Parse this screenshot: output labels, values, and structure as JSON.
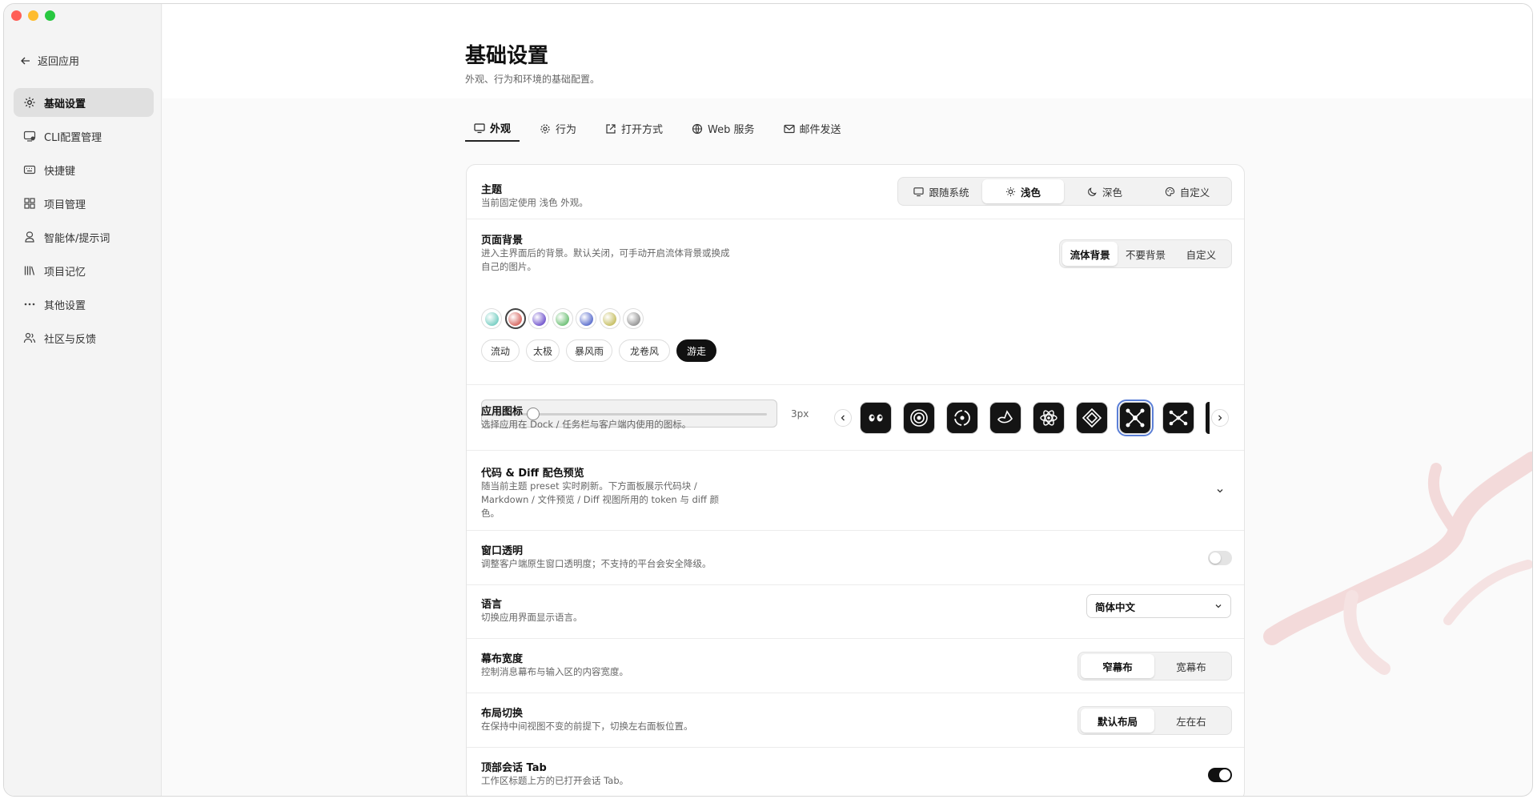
{
  "window": {
    "colors": {
      "close": "#ff5f57",
      "minimize": "#febc2e",
      "zoom": "#28c840"
    }
  },
  "sidebar": {
    "back_label": "返回应用",
    "items": [
      {
        "label": "基础设置",
        "icon": "gear-icon",
        "active": true
      },
      {
        "label": "CLI配置管理",
        "icon": "monitor-icon"
      },
      {
        "label": "快捷键",
        "icon": "keyboard-icon"
      },
      {
        "label": "项目管理",
        "icon": "grid-icon"
      },
      {
        "label": "智能体/提示词",
        "icon": "agent-icon"
      },
      {
        "label": "项目记忆",
        "icon": "library-icon"
      },
      {
        "label": "其他设置",
        "icon": "more-icon"
      },
      {
        "label": "社区与反馈",
        "icon": "users-icon"
      }
    ]
  },
  "page": {
    "title": "基础设置",
    "subtitle": "外观、行为和环境的基础配置。"
  },
  "tabs": [
    {
      "label": "外观",
      "icon": "monitor-icon",
      "active": true
    },
    {
      "label": "行为",
      "icon": "gear-icon"
    },
    {
      "label": "打开方式",
      "icon": "external-link-icon"
    },
    {
      "label": "Web 服务",
      "icon": "globe-icon"
    },
    {
      "label": "邮件发送",
      "icon": "mail-icon"
    }
  ],
  "theme": {
    "title": "主题",
    "desc": "当前固定使用 浅色 外观。",
    "options": [
      "跟随系统",
      "浅色",
      "深色",
      "自定义"
    ],
    "selected": "浅色"
  },
  "background": {
    "title": "页面背景",
    "desc": "进入主界面后的背景。默认关闭，可手动开启流体背景或换成自己的图片。",
    "modes": [
      "流体背景",
      "不要背景",
      "自定义"
    ],
    "selected_mode": "流体背景",
    "swatches": [
      "#7fd1c6",
      "#d9706a",
      "#7a5fd0",
      "#76c47e",
      "#6577d0",
      "#c9c26b",
      "#9a9a9a"
    ],
    "selected_swatch": 1,
    "styles": [
      "流动",
      "太极",
      "暴风雨",
      "龙卷风",
      "游走"
    ],
    "selected_style": "游走",
    "slider_value": "3px",
    "slider_fraction": 0.15
  },
  "app_icon": {
    "title": "应用图标",
    "desc": "选择应用在 Dock / 任务栏与客户端内使用的图标。",
    "icons": [
      "eyes-icon",
      "target-icon",
      "orbit-icon",
      "bird-icon",
      "atom-icon",
      "diamond-icon",
      "network-icon",
      "nodes-icon"
    ],
    "selected_index": 6
  },
  "code_preview": {
    "title": "代码 & Diff 配色预览",
    "desc": "随当前主题 preset 实时刷新。下方面板展示代码块 / Markdown / 文件预览 / Diff 视图所用的 token 与 diff 颜色。"
  },
  "transparency": {
    "title": "窗口透明",
    "desc": "调整客户端原生窗口透明度；不支持的平台会安全降级。",
    "enabled": false
  },
  "language": {
    "title": "语言",
    "desc": "切换应用界面显示语言。",
    "value": "简体中文"
  },
  "canvas_width": {
    "title": "幕布宽度",
    "desc": "控制消息幕布与输入区的内容宽度。",
    "options": [
      "窄幕布",
      "宽幕布"
    ],
    "selected": "窄幕布"
  },
  "layout": {
    "title": "布局切换",
    "desc": "在保持中间视图不变的前提下，切换左右面板位置。",
    "options": [
      "默认布局",
      "左在右"
    ],
    "selected": "默认布局"
  },
  "top_tab": {
    "title": "顶部会话 Tab",
    "desc": "工作区标题上方的已打开会话 Tab。",
    "enabled": true
  }
}
